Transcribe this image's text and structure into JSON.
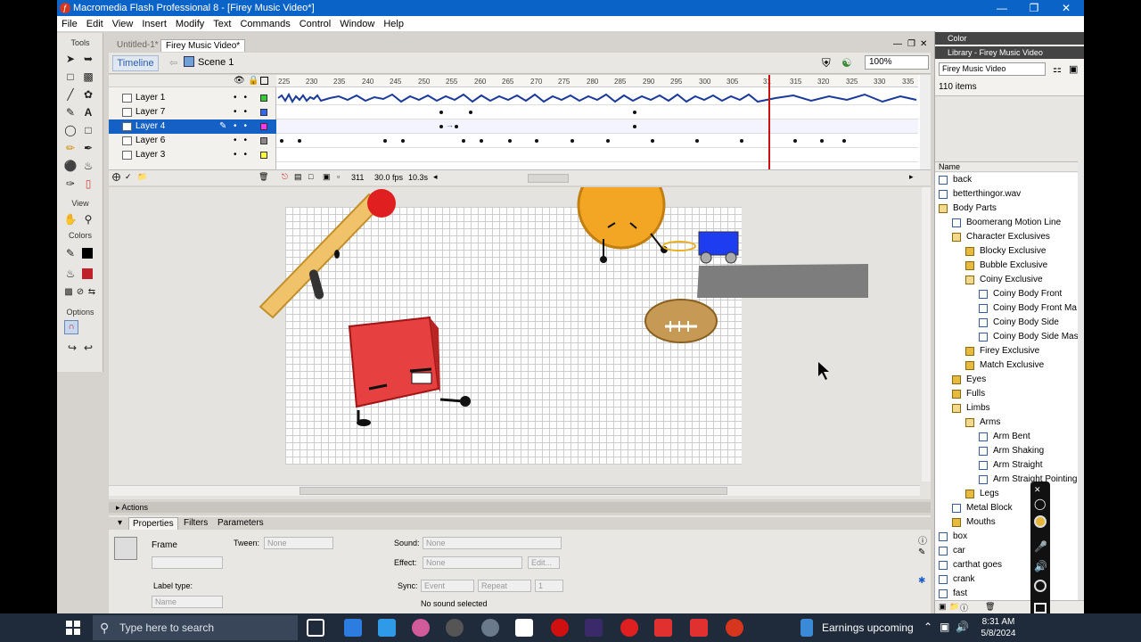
{
  "window": {
    "title": "Macromedia Flash Professional 8 - [Firey Music Video*]",
    "app_icon_glyph": "ƒ"
  },
  "menu": [
    "File",
    "Edit",
    "View",
    "Insert",
    "Modify",
    "Text",
    "Commands",
    "Control",
    "Window",
    "Help"
  ],
  "tools": {
    "title": "Tools",
    "view_label": "View",
    "colors_label": "Colors",
    "options_label": "Options"
  },
  "doc_tabs": [
    "Untitled-1*",
    "Firey Music Video*"
  ],
  "timeline": {
    "button": "Timeline",
    "scene": "Scene 1",
    "zoom": "100%",
    "frame_numbers": [
      "225",
      "230",
      "235",
      "240",
      "245",
      "250",
      "255",
      "260",
      "265",
      "270",
      "275",
      "280",
      "285",
      "290",
      "295",
      "300",
      "305",
      "31",
      "315",
      "320",
      "325",
      "330",
      "335"
    ],
    "layers": [
      {
        "name": "Layer 1",
        "color": "#33cc33",
        "selected": false
      },
      {
        "name": "Layer 7",
        "color": "#3366ff",
        "selected": false
      },
      {
        "name": "Layer 4",
        "color": "#ff33ff",
        "selected": true
      },
      {
        "name": "Layer 6",
        "color": "#888888",
        "selected": false
      },
      {
        "name": "Layer 3",
        "color": "#ffff33",
        "selected": false
      }
    ],
    "current_frame": "311",
    "fps": "30.0 fps",
    "time": "10.3s"
  },
  "actions_label": "Actions",
  "properties": {
    "tabs": [
      "Properties",
      "Filters",
      "Parameters"
    ],
    "frame_label": "Frame",
    "tween_label": "Tween:",
    "tween_value": "None",
    "sound_label": "Sound:",
    "sound_value": "None",
    "effect_label": "Effect:",
    "effect_value": "None",
    "edit_button": "Edit...",
    "sync_label": "Sync:",
    "sync_value": "Event",
    "repeat_value": "Repeat",
    "repeat_count": "1",
    "no_sound": "No sound selected",
    "label_type_label": "Label type:",
    "label_type_value": "Name"
  },
  "right_panel": {
    "color_header": "Color",
    "library_header": "Library - Firey Music Video",
    "library_select": "Firey Music Video",
    "item_count": "110 items",
    "name_column": "Name",
    "items": [
      {
        "name": "back",
        "kind": "sym",
        "indent": 0
      },
      {
        "name": "betterthingor.wav",
        "kind": "snd",
        "indent": 0
      },
      {
        "name": "Body Parts",
        "kind": "folderopen",
        "indent": 0
      },
      {
        "name": "Boomerang Motion Line",
        "kind": "sym",
        "indent": 1
      },
      {
        "name": "Character Exclusives",
        "kind": "folderopen",
        "indent": 1
      },
      {
        "name": "Blocky Exclusive",
        "kind": "folder",
        "indent": 2
      },
      {
        "name": "Bubble Exclusive",
        "kind": "folder",
        "indent": 2
      },
      {
        "name": "Coiny Exclusive",
        "kind": "folderopen",
        "indent": 2
      },
      {
        "name": "Coiny Body Front",
        "kind": "sym",
        "indent": 3
      },
      {
        "name": "Coiny Body Front Ma",
        "kind": "sym",
        "indent": 3
      },
      {
        "name": "Coiny Body Side",
        "kind": "sym",
        "indent": 3
      },
      {
        "name": "Coiny Body Side Masl",
        "kind": "sym",
        "indent": 3
      },
      {
        "name": "Firey Exclusive",
        "kind": "folder",
        "indent": 2
      },
      {
        "name": "Match Exclusive",
        "kind": "folder",
        "indent": 2
      },
      {
        "name": "Eyes",
        "kind": "folder",
        "indent": 1
      },
      {
        "name": "Fulls",
        "kind": "folder",
        "indent": 1
      },
      {
        "name": "Limbs",
        "kind": "folderopen",
        "indent": 1
      },
      {
        "name": "Arms",
        "kind": "folderopen",
        "indent": 2
      },
      {
        "name": "Arm Bent",
        "kind": "sym",
        "indent": 3
      },
      {
        "name": "Arm Shaking",
        "kind": "sym",
        "indent": 3
      },
      {
        "name": "Arm Straight",
        "kind": "sym",
        "indent": 3
      },
      {
        "name": "Arm Straight Pointing",
        "kind": "sym",
        "indent": 3
      },
      {
        "name": "Legs",
        "kind": "folder",
        "indent": 2
      },
      {
        "name": "Metal Block",
        "kind": "sym",
        "indent": 1
      },
      {
        "name": "Mouths",
        "kind": "folder",
        "indent": 1
      },
      {
        "name": "box",
        "kind": "sym",
        "indent": 0
      },
      {
        "name": "car",
        "kind": "sym",
        "indent": 0
      },
      {
        "name": "carthat goes",
        "kind": "sym",
        "indent": 0
      },
      {
        "name": "crank",
        "kind": "sym",
        "indent": 0
      },
      {
        "name": "fast",
        "kind": "sym",
        "indent": 0
      }
    ]
  },
  "taskbar": {
    "search_placeholder": "Type here to search",
    "news": "Earnings upcoming",
    "time": "8:31 AM",
    "date": "5/8/2024"
  }
}
